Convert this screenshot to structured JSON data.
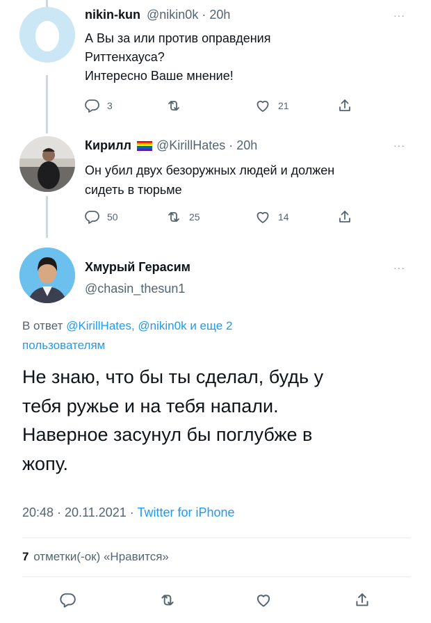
{
  "tweet1": {
    "name": "nikin-kun",
    "meta": "@nikin0k · 20h",
    "lines": [
      "А Вы за или против оправдения",
      "Риттенхауса?",
      "Интересно Ваше мнение!"
    ],
    "replies": "3",
    "retweets": "",
    "likes": "21",
    "more": "···"
  },
  "tweet2": {
    "name": "Кирилл",
    "meta": "@KirillHates · 20h",
    "lines": [
      "Он убил двух безоружных людей и должен",
      "сидеть в тюрьме"
    ],
    "replies": "50",
    "retweets": "25",
    "likes": "14",
    "more": "···"
  },
  "main": {
    "name": "Хмурый Герасим",
    "handle": "@chasin_thesun1",
    "reply_prefix": "В ответ",
    "reply_users": "@KirillHates, @nikin0k",
    "reply_suffix": "и еще 2",
    "reply_line2": "пользователям",
    "body": [
      "Не знаю, что бы ты сделал, будь у",
      "тебя ружье и на тебя напали.",
      "Наверное засунул бы поглубже в",
      "жопу."
    ],
    "timestamp": "20:48 · 20.11.2021 · ",
    "client": "Twitter for iPhone",
    "likes_count": "7",
    "likes_label": "отметки(-ок) «Нравится»",
    "more": "···"
  },
  "colors": {
    "link": "#1d9bf0",
    "muted": "#536471",
    "thread": "#cfd9de"
  }
}
